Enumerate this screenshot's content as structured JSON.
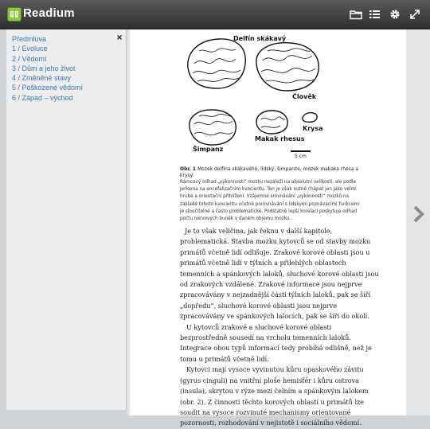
{
  "app": {
    "title": "Readium"
  },
  "toolbar": {
    "icons": [
      "open-folder-icon",
      "list-icon",
      "gear-icon",
      "fullscreen-icon"
    ]
  },
  "toc": {
    "items": [
      {
        "label": "Předmluva"
      },
      {
        "label": "1 / Evoluce"
      },
      {
        "label": "2 / Vědomí"
      },
      {
        "label": "3 / Dům a jeho život"
      },
      {
        "label": "4 / Změněné stavy"
      },
      {
        "label": "5 / Poškozené vědomí"
      },
      {
        "label": "6 / Západ – východ"
      }
    ],
    "close_label": "×"
  },
  "figure": {
    "labels": {
      "dolphin": "Delfín skákavý",
      "human": "Člověk",
      "chimp": "Šimpanz",
      "macaque": "Makak rhesus",
      "rat": "Krysa",
      "scale": "5 cm"
    },
    "caption_label": "Obr. 1",
    "caption": "Mozek delfína skákavého, lidský, šimpanze, mozek makaka rhesa a krysy.",
    "note": "Rámcový odhad „výkonnosti“ mozku nezáleží na absolutní velikosti, ale podle Jerisona na encefalizačním kvocientu. Ten je však nutně chápat jen jako velmi hrubé a orientační přiblížení. Vzájemné srovnávání „výkonnosti“ mozků na základě tohoto kvocientu včetně porovnávání s lidskými poznávacími funkcemi je sloučitelné a často problematické. Podstatně lepší korelaci poskytuje odhad počtu nervových buněk v daném objemu mozku."
  },
  "body": {
    "paragraphs": [
      "Je to však veličina, jak řeknu v další kapitole, problematická. Stavba mozku kytovců se od stavby mozku primátů včetně lidí odlišuje. Zrakové korové oblasti jsou u primátů včetně lidí v týlních a přilehlých oblastech temenních a spánkových laloků, sluchové korové oblasti jsou od zrakových vzdálené. Zrakové informace jsou nejprve zpracovávány v nejzadnější části týlních laloků, pak se šíří „dopředu“, sluchové korové oblasti jsou nejprve zpracovávány ve spánkových lalocích, pak se šíří do okolí.",
      "U kytovců zrakové a sluchové korové oblasti bezprostředně sousedí na vrcholu temenních laloků. Integrace obou typů informací tedy probíhá odlišně, než je tomu u primátů včetně lidí.",
      "Kytovci mají vysoce vyvinutou kůru opaskového závitu (gyrus cinguli) na vnitřní ploše hemisfér i kůru ostrova (insula), skrytou v rýze mezi čelním a spánkovým lalokem (obr. 2). Z činností těchto korových oblastí u primátů lze soudit na vysoce rozvinuté mechanismy orientované pozornosti, rozhodování v nejistotě i sociálního vědomí."
    ]
  }
}
